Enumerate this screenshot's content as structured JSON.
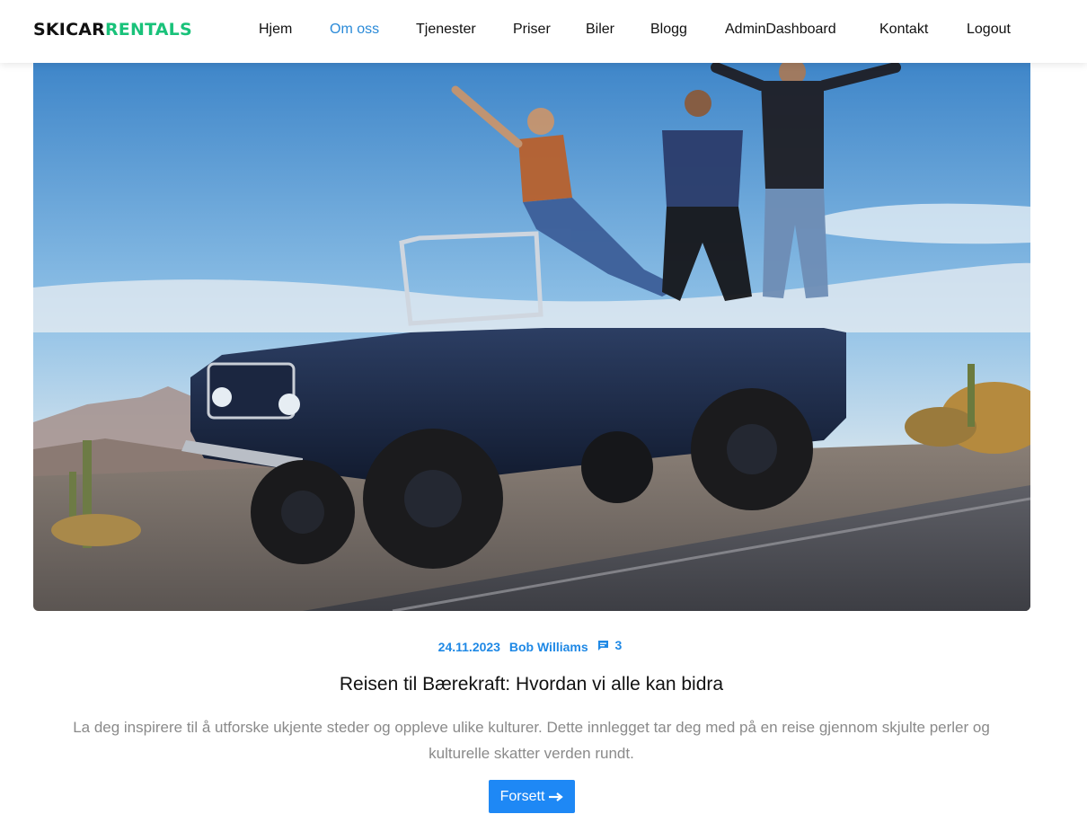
{
  "brand": {
    "part1": "SKICAR",
    "part2": "RENTALS",
    "accent": "#19c27a"
  },
  "nav": {
    "items": [
      {
        "label": "Hjem"
      },
      {
        "label": "Om oss",
        "active": true
      },
      {
        "label": "Tjenester"
      },
      {
        "label": "Priser"
      },
      {
        "label": "Biler"
      },
      {
        "label": "Blogg"
      },
      {
        "label": "AdminDashboard"
      },
      {
        "label": "Kontakt"
      },
      {
        "label": "Logout"
      }
    ],
    "active_color": "#2a8ad8"
  },
  "post": {
    "date": "24.11.2023",
    "author": "Bob Williams",
    "comments": "3",
    "comment_icon": "chat-bubble-icon",
    "title": "Reisen til Bærekraft: Hvordan vi alle kan bidra",
    "excerpt": "La deg inspirere til å utforske ukjente steder og oppleve ulike kulturer. Dette innlegget tar deg med på en reise gjennom skjulte perler og kulturelle skatter verden rundt.",
    "button_label": "Forsett",
    "button_icon": "arrow-right-icon",
    "link_color": "#1e88e5"
  }
}
